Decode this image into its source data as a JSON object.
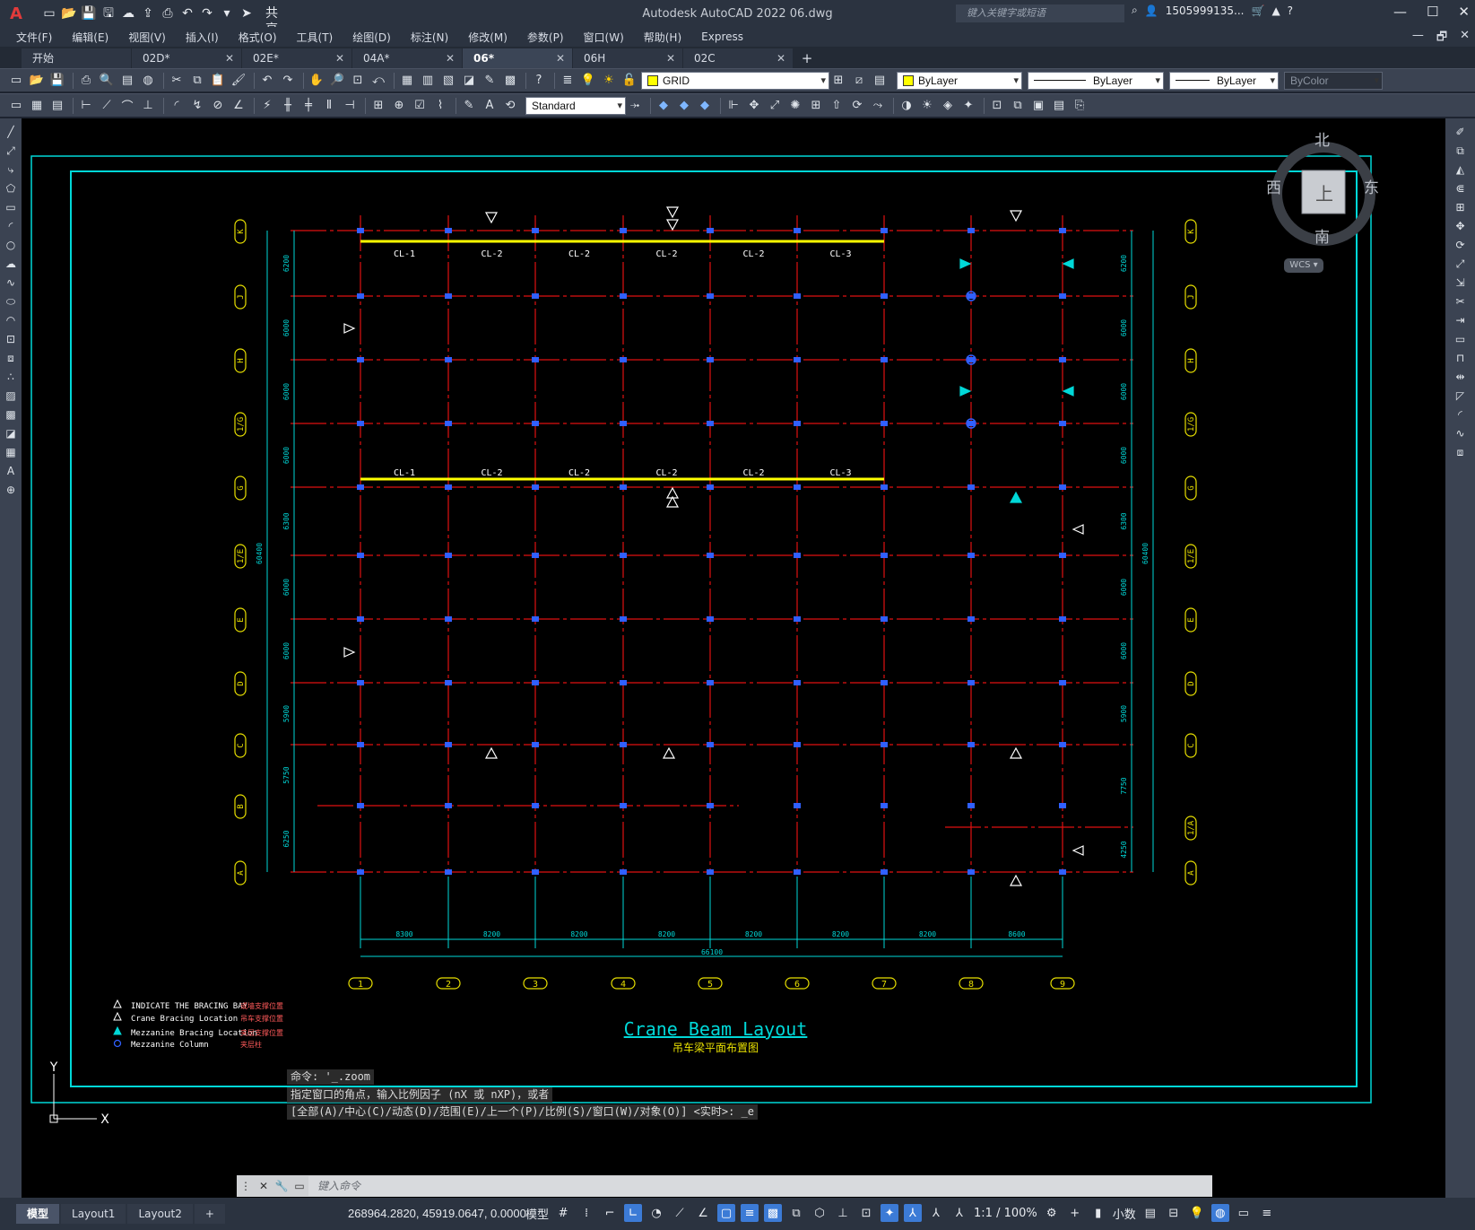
{
  "app": {
    "title": "Autodesk AutoCAD 2022    06.dwg",
    "logo": "A",
    "share_label": "共享",
    "search_placeholder": "键入关键字或短语",
    "user": "1505999135...",
    "window_buttons": [
      "—",
      "☐",
      "✕"
    ]
  },
  "menu": {
    "items": [
      "文件(F)",
      "编辑(E)",
      "视图(V)",
      "插入(I)",
      "格式(O)",
      "工具(T)",
      "绘图(D)",
      "标注(N)",
      "修改(M)",
      "参数(P)",
      "窗口(W)",
      "帮助(H)",
      "Express"
    ],
    "mdi_buttons": [
      "—",
      "🗗",
      "✕"
    ]
  },
  "tabs": [
    {
      "label": "开始",
      "closable": false,
      "active": false
    },
    {
      "label": "02D*",
      "closable": true,
      "active": false
    },
    {
      "label": "02E*",
      "closable": true,
      "active": false
    },
    {
      "label": "04A*",
      "closable": true,
      "active": false
    },
    {
      "label": "06*",
      "closable": true,
      "active": true
    },
    {
      "label": "06H",
      "closable": true,
      "active": false
    },
    {
      "label": "02C",
      "closable": true,
      "active": false
    }
  ],
  "properties": {
    "layer": "GRID",
    "color": "ByLayer",
    "linetype": "ByLayer",
    "lineweight": "ByLayer",
    "plotstyle": "ByColor",
    "text_style": "Standard",
    "layer_color_hex": "#ffff00"
  },
  "drawing": {
    "title": "Crane  Beam  Layout",
    "subtitle": "吊车梁平面布置图",
    "col_labels": [
      "1",
      "2",
      "3",
      "4",
      "5",
      "6",
      "7",
      "8",
      "9"
    ],
    "row_labels_left": [
      "K",
      "J",
      "H",
      "1/G",
      "G",
      "1/E",
      "E",
      "D",
      "C",
      "B",
      "A"
    ],
    "row_labels_right": [
      "K",
      "J",
      "H",
      "1/G",
      "G",
      "1/E",
      "E",
      "D",
      "C",
      "1/A",
      "A"
    ],
    "bay_dims": [
      "8300",
      "8200",
      "8200",
      "8200",
      "8200",
      "8200",
      "8200",
      "8600"
    ],
    "overall_dim": "66100",
    "left_dims": [
      "6200",
      "6000",
      "6000",
      "6000",
      "6300",
      "6000",
      "6000",
      "5900",
      "5750",
      "6250"
    ],
    "left_overall": "60400",
    "right_dims": [
      "6200",
      "6000",
      "6000",
      "6000",
      "6300",
      "6000",
      "6000",
      "5900",
      "7750",
      "4250"
    ],
    "right_overall": "60400",
    "crane_beams_top": [
      "CL-1",
      "CL-2",
      "CL-2",
      "CL-2",
      "CL-2",
      "CL-3"
    ],
    "crane_beams_mid": [
      "CL-1",
      "CL-2",
      "CL-2",
      "CL-2",
      "CL-2",
      "CL-3"
    ],
    "legend": [
      {
        "en": "INDICATE  THE  BRACING  BAY",
        "zh": "或墙支撑位置"
      },
      {
        "en": "Crane  Bracing  Location",
        "zh": "吊车支撑位置"
      },
      {
        "en": "Mezzanine  Bracing  Location",
        "zh": "夹层支撑位置"
      },
      {
        "en": "Mezzanine  Column",
        "zh": "夹层柱"
      }
    ],
    "axis_y": "Y",
    "axis_x": "X"
  },
  "viewcube": {
    "north": "北",
    "south": "南",
    "east": "东",
    "west": "西",
    "top": "上",
    "wcs": "WCS"
  },
  "command": {
    "history": [
      "命令: '_.zoom",
      "指定窗口的角点，输入比例因子 (nX 或 nXP)，或者",
      "[全部(A)/中心(C)/动态(D)/范围(E)/上一个(P)/比例(S)/窗口(W)/对象(O)] <实时>: _e"
    ],
    "placeholder": "键入命令"
  },
  "status": {
    "layout_tabs": [
      "模型",
      "Layout1",
      "Layout2"
    ],
    "coords": "268964.2820, 45919.0647, 0.0000",
    "model_label": "模型",
    "scale": "1:1 / 100%",
    "units": "小数"
  },
  "colors": {
    "grid_line": "#e01010",
    "dim_cyan": "#00d8d8",
    "axis_yellow": "#e8e000",
    "crane_beam": "#ffff00",
    "column_blue": "#3060ff",
    "text_white": "#ffffff"
  }
}
